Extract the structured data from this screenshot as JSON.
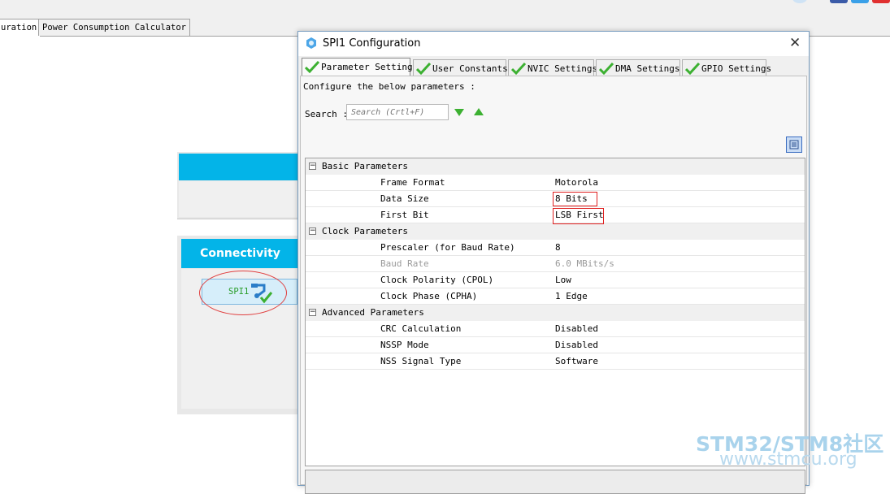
{
  "main_tabs": [
    {
      "label": "uration",
      "active": true
    },
    {
      "label": "Power Consumption Calculator",
      "active": false
    }
  ],
  "connectivity": {
    "header": "Connectivity",
    "spi_label": "SPI1",
    "spi_icon": "spi-peripheral-check-icon"
  },
  "dialog": {
    "title": "SPI1 Configuration",
    "close": "✕",
    "tabs": [
      {
        "label": "Parameter Settings",
        "active": true
      },
      {
        "label": "User Constants",
        "active": false
      },
      {
        "label": "NVIC Settings",
        "active": false
      },
      {
        "label": "DMA Settings",
        "active": false
      },
      {
        "label": "GPIO Settings",
        "active": false
      }
    ],
    "configure_text": "Configure the below parameters :",
    "search": {
      "label": "Search :",
      "placeholder": "Search (Crtl+F)"
    },
    "groups": [
      {
        "name": "Basic Parameters",
        "params": [
          {
            "name": "Frame Format",
            "value": "Motorola"
          },
          {
            "name": "Data Size",
            "value": "8 Bits",
            "highlighted": true
          },
          {
            "name": "First Bit",
            "value": "LSB First",
            "highlighted": true
          }
        ]
      },
      {
        "name": "Clock Parameters",
        "params": [
          {
            "name": "Prescaler (for Baud Rate)",
            "value": "8"
          },
          {
            "name": "Baud Rate",
            "value": "6.0 MBits/s",
            "disabled": true
          },
          {
            "name": "Clock Polarity (CPOL)",
            "value": "Low"
          },
          {
            "name": "Clock Phase (CPHA)",
            "value": "1 Edge"
          }
        ]
      },
      {
        "name": "Advanced Parameters",
        "params": [
          {
            "name": "CRC Calculation",
            "value": "Disabled"
          },
          {
            "name": "NSSP Mode",
            "value": "Disabled"
          },
          {
            "name": "NSS Signal Type",
            "value": "Software"
          }
        ]
      }
    ]
  },
  "watermark": {
    "line1": "STM32/STM8社区",
    "line2": "www.stmcu.org"
  },
  "colors": {
    "accent": "#03b4e8",
    "highlight": "#e02020",
    "check": "#3cb031"
  }
}
